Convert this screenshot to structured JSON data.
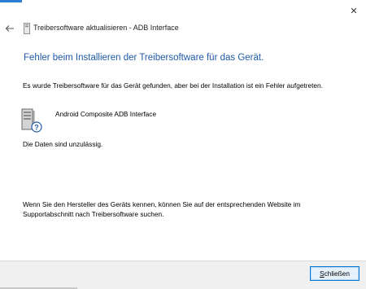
{
  "window": {
    "title": "Treibersoftware aktualisieren - ADB Interface",
    "close_glyph": "✕",
    "back_glyph": "←"
  },
  "main": {
    "heading": "Fehler beim Installieren der Treibersoftware für das Gerät.",
    "message": "Es wurde Treibersoftware für das Gerät gefunden, aber bei der Installation ist ein Fehler aufgetreten.",
    "device_name": "Android Composite ADB Interface",
    "error_detail": "Die Daten sind unzulässig.",
    "hint": "Wenn Sie den Hersteller des Geräts kennen, können Sie auf der entsprechenden Website im Supportabschnitt nach Treibersoftware suchen."
  },
  "footer": {
    "close_button_mnemonic": "S",
    "close_button_rest": "chließen"
  },
  "colors": {
    "heading": "#1e5aa8",
    "button_border": "#0078d7",
    "footer_bg": "#f0f0f0"
  },
  "icons": [
    "close-icon",
    "back-arrow-icon",
    "device-manager-icon",
    "device-unknown-icon"
  ]
}
